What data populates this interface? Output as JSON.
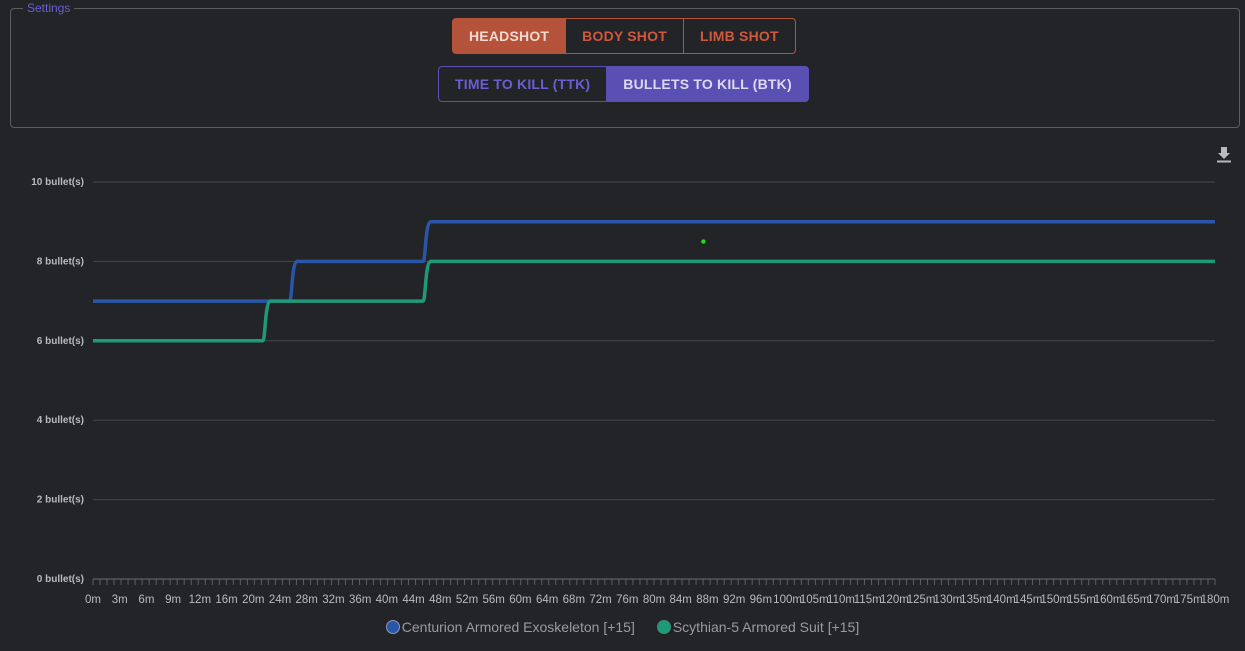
{
  "settings": {
    "legend": "Settings",
    "shot_buttons": [
      {
        "label": "HEADSHOT",
        "active": true
      },
      {
        "label": "BODY SHOT",
        "active": false
      },
      {
        "label": "LIMB SHOT",
        "active": false
      }
    ],
    "mode_buttons": [
      {
        "label": "TIME TO KILL (TTK)",
        "active": false
      },
      {
        "label": "BULLETS TO KILL (BTK)",
        "active": true
      }
    ]
  },
  "toolbar": {
    "download_icon": "download-icon"
  },
  "colors": {
    "headshot_accent": "#b5533a",
    "mode_accent": "#5a4fb3",
    "series_1": "#2a56a8",
    "series_2": "#1f9a78",
    "marker": "#22dd22"
  },
  "chart_data": {
    "type": "line",
    "x": [
      "0m",
      "3m",
      "6m",
      "9m",
      "12m",
      "16m",
      "20m",
      "24m",
      "28m",
      "32m",
      "36m",
      "40m",
      "44m",
      "48m",
      "52m",
      "56m",
      "60m",
      "64m",
      "68m",
      "72m",
      "76m",
      "80m",
      "84m",
      "88m",
      "92m",
      "96m",
      "100m",
      "105m",
      "110m",
      "115m",
      "120m",
      "125m",
      "130m",
      "135m",
      "140m",
      "145m",
      "150m",
      "155m",
      "160m",
      "165m",
      "170m",
      "175m",
      "180m"
    ],
    "series": [
      {
        "name": "Centurion Armored Exoskeleton [+15]",
        "values": [
          7,
          7,
          7,
          7,
          7,
          7,
          7,
          7,
          8,
          8,
          8,
          8,
          8,
          9,
          9,
          9,
          9,
          9,
          9,
          9,
          9,
          9,
          9,
          9,
          9,
          9,
          9,
          9,
          9,
          9,
          9,
          9,
          9,
          9,
          9,
          9,
          9,
          9,
          9,
          9,
          9,
          9,
          9
        ],
        "color": "#2a56a8"
      },
      {
        "name": "Scythian-5 Armored Suit [+15]",
        "values": [
          6,
          6,
          6,
          6,
          6,
          6,
          6,
          7,
          7,
          7,
          7,
          7,
          7,
          8,
          8,
          8,
          8,
          8,
          8,
          8,
          8,
          8,
          8,
          8,
          8,
          8,
          8,
          8,
          8,
          8,
          8,
          8,
          8,
          8,
          8,
          8,
          8,
          8,
          8,
          8,
          8,
          8,
          8
        ],
        "color": "#1f9a78"
      }
    ],
    "y_ticks": [
      "0 bullet(s)",
      "2 bullet(s)",
      "4 bullet(s)",
      "6 bullet(s)",
      "8 bullet(s)",
      "10 bullet(s)"
    ],
    "ylim": [
      0,
      10
    ],
    "grid": true,
    "legend_position": "bottom-center",
    "marker_point": {
      "x": "88m",
      "y": 8.5
    }
  }
}
